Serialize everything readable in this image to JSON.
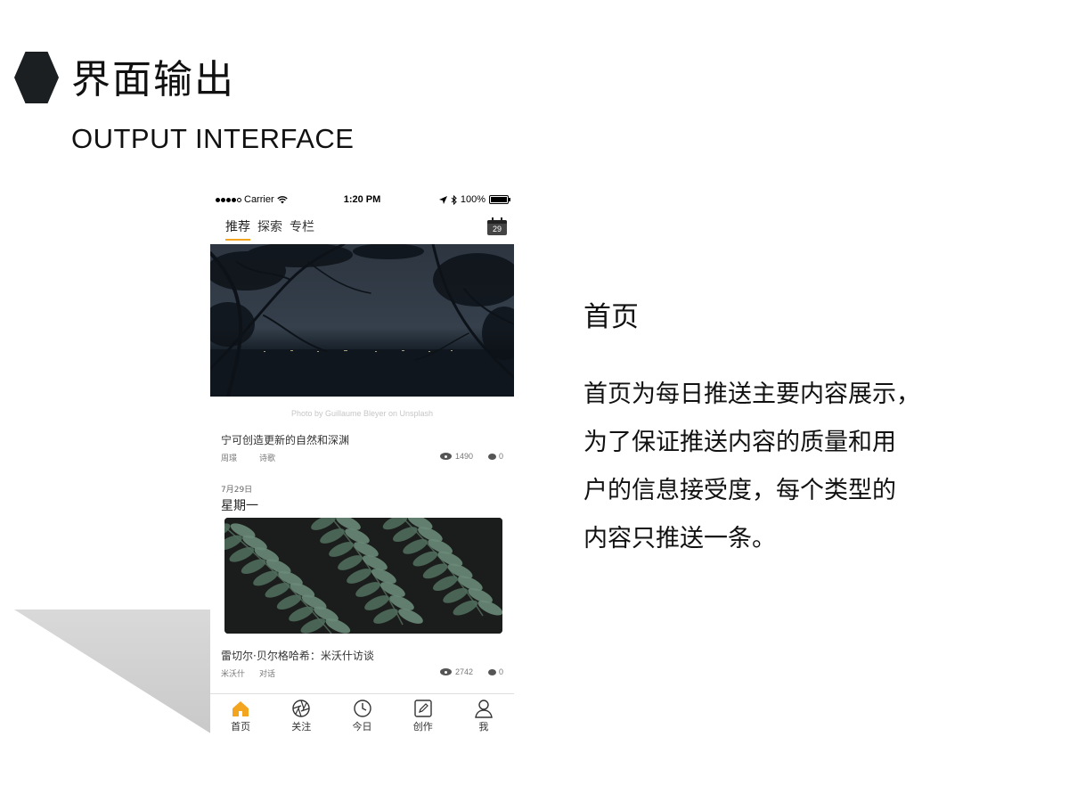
{
  "slide": {
    "title": "界面输出",
    "subtitle": "OUTPUT INTERFACE"
  },
  "status_bar": {
    "carrier": "Carrier",
    "time": "1:20 PM",
    "battery": "100%",
    "battery_level": 1.0
  },
  "top_tabs": [
    {
      "label": "推荐",
      "active": true
    },
    {
      "label": "探索",
      "active": false
    },
    {
      "label": "专栏",
      "active": false
    }
  ],
  "calendar": {
    "day": "29"
  },
  "hero": {
    "photo_credit": "Photo by Guillaume Bleyer on Unsplash"
  },
  "articles": [
    {
      "title": "宁可创造更新的自然和深渊",
      "author": "周璟",
      "category": "诗歌",
      "views": "1490",
      "comments": "0"
    },
    {
      "title": "雷切尔·贝尔格哈希：米沃什访谈",
      "author": "米沃什",
      "category": "对话",
      "views": "2742",
      "comments": "0"
    }
  ],
  "day_section": {
    "date": "7月29日",
    "weekday": "星期一"
  },
  "bottom_nav": [
    {
      "label": "首页",
      "icon": "home-icon",
      "active": true
    },
    {
      "label": "关注",
      "icon": "aperture-icon",
      "active": false
    },
    {
      "label": "今日",
      "icon": "clock-icon",
      "active": false
    },
    {
      "label": "创作",
      "icon": "edit-icon",
      "active": false
    },
    {
      "label": "我",
      "icon": "user-icon",
      "active": false
    }
  ],
  "description": {
    "heading": "首页",
    "lines": [
      "首页为每日推送主要内容展示，",
      "为了保证推送内容的质量和用",
      "户的信息接受度，每个类型的",
      "内容只推送一条。"
    ]
  },
  "colors": {
    "accent": "#f3a51f",
    "hexagon": "#1c1f22"
  }
}
